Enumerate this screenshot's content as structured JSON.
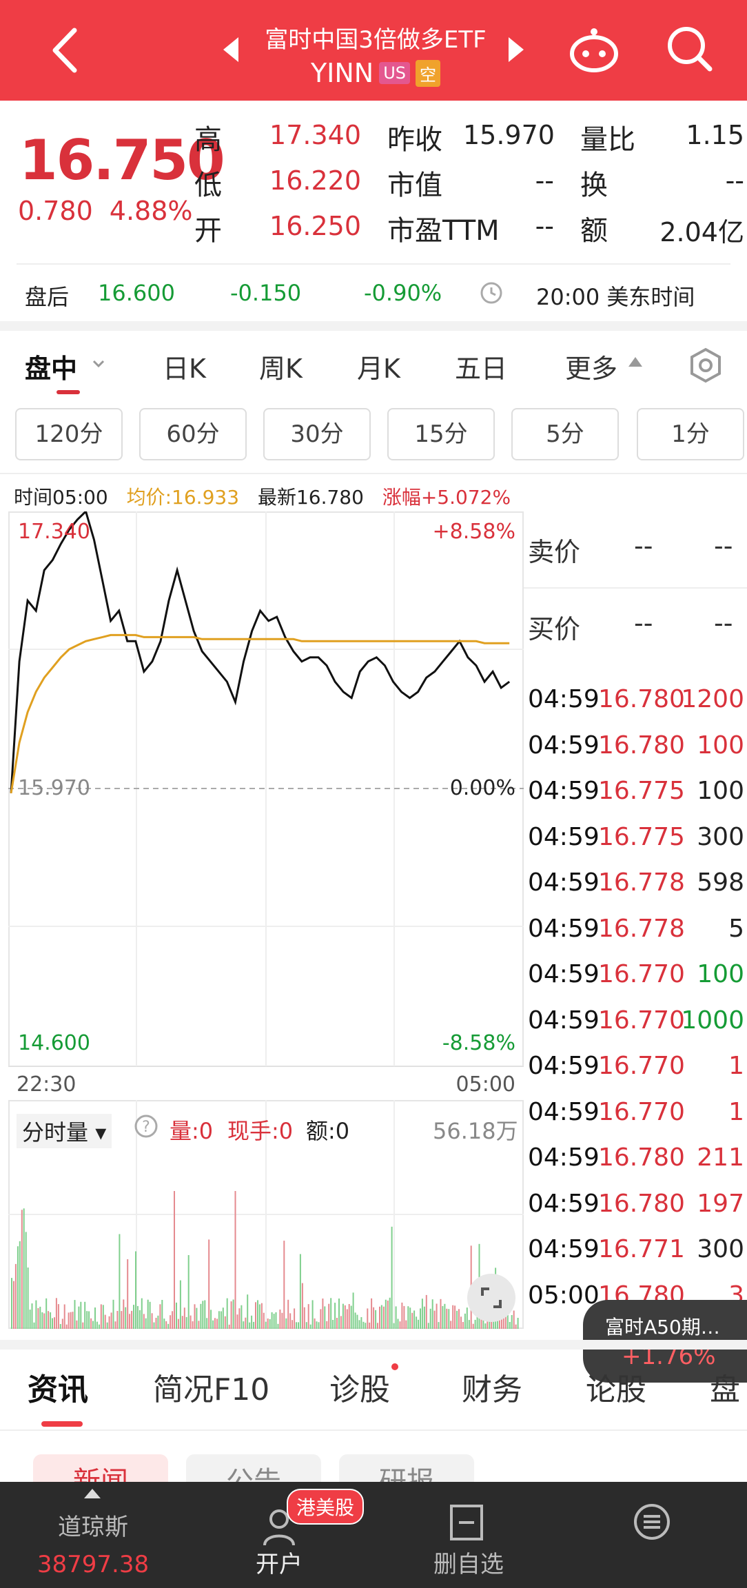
{
  "header": {
    "title": "富时中国3倍做多ETF",
    "ticker": "YINN",
    "market_badge": "US",
    "short_badge": "空",
    "icons": [
      "back-icon",
      "prev-icon",
      "next-icon",
      "bot-icon",
      "search-icon"
    ]
  },
  "quote": {
    "price": "16.750",
    "change": "0.780",
    "change_pct": "4.88%",
    "rows": [
      {
        "l1": "高",
        "v1": "17.340",
        "l2": "昨收",
        "v2": "15.970",
        "l3": "量比",
        "v3": "1.15"
      },
      {
        "l1": "低",
        "v1": "16.220",
        "l2": "市值",
        "v2": "--",
        "l3": "换",
        "v3": "--"
      },
      {
        "l1": "开",
        "v1": "16.250",
        "l2": "市盈TTM",
        "v2": "--",
        "l3": "额",
        "v3": "2.04亿"
      }
    ]
  },
  "after_hours": {
    "label": "盘后",
    "price": "16.600",
    "change": "-0.150",
    "change_pct": "-0.90%",
    "time": "20:00 美东时间"
  },
  "tabs": [
    "盘中",
    "日K",
    "周K",
    "月K",
    "五日",
    "更多"
  ],
  "periods": [
    "120分",
    "60分",
    "30分",
    "15分",
    "5分",
    "1分"
  ],
  "info_line": {
    "time": "时间05:00",
    "avg": "均价:16.933",
    "latest": "最新16.780",
    "change": "涨幅+5.072%"
  },
  "chart_data": {
    "type": "line",
    "y_high_label": "17.340",
    "y_low_label": "14.600",
    "y_mid_label": "15.970",
    "pct_high": "+8.58%",
    "pct_mid": "0.00%",
    "pct_low": "-8.58%",
    "x_start": "22:30",
    "x_end": "05:00",
    "ylim": [
      14.6,
      17.34
    ],
    "series": [
      {
        "values": [
          15.95,
          16.6,
          16.9,
          16.85,
          17.05,
          17.1,
          17.18,
          17.25,
          17.3,
          17.34,
          17.2,
          17.0,
          16.8,
          16.85,
          16.7,
          16.7,
          16.55,
          16.6,
          16.7,
          16.9,
          17.05,
          16.9,
          16.75,
          16.65,
          16.6,
          16.55,
          16.5,
          16.4,
          16.6,
          16.75,
          16.85,
          16.8,
          16.82,
          16.72,
          16.65,
          16.6,
          16.62,
          16.62,
          16.58,
          16.5,
          16.45,
          16.42,
          16.55,
          16.6,
          16.62,
          16.58,
          16.5,
          16.45,
          16.42,
          16.45,
          16.52,
          16.55,
          16.6,
          16.65,
          16.7,
          16.62,
          16.58,
          16.5,
          16.55,
          16.47,
          16.5
        ]
      },
      {
        "values": [
          15.95,
          16.2,
          16.35,
          16.45,
          16.52,
          16.57,
          16.62,
          16.66,
          16.68,
          16.7,
          16.71,
          16.72,
          16.73,
          16.73,
          16.73,
          16.73,
          16.72,
          16.72,
          16.72,
          16.72,
          16.72,
          16.72,
          16.72,
          16.71,
          16.71,
          16.71,
          16.71,
          16.71,
          16.71,
          16.71,
          16.71,
          16.71,
          16.71,
          16.71,
          16.71,
          16.7,
          16.7,
          16.7,
          16.7,
          16.7,
          16.7,
          16.7,
          16.7,
          16.7,
          16.7,
          16.7,
          16.7,
          16.7,
          16.7,
          16.7,
          16.7,
          16.7,
          16.7,
          16.7,
          16.7,
          16.7,
          16.7,
          16.69,
          16.69,
          16.69,
          16.69
        ]
      }
    ]
  },
  "book": {
    "ask_label": "卖价",
    "bid_label": "买价",
    "ask_price": "--",
    "ask_size": "--",
    "bid_price": "--",
    "bid_size": "--",
    "ticks": [
      {
        "t": "04:59",
        "p": "16.780",
        "v": "1200",
        "c": "red"
      },
      {
        "t": "04:59",
        "p": "16.780",
        "v": "100",
        "c": "red"
      },
      {
        "t": "04:59",
        "p": "16.775",
        "v": "100",
        "c": "dark"
      },
      {
        "t": "04:59",
        "p": "16.775",
        "v": "300",
        "c": "dark"
      },
      {
        "t": "04:59",
        "p": "16.778",
        "v": "598",
        "c": "dark"
      },
      {
        "t": "04:59",
        "p": "16.778",
        "v": "5",
        "c": "dark"
      },
      {
        "t": "04:59",
        "p": "16.770",
        "v": "100",
        "c": "green"
      },
      {
        "t": "04:59",
        "p": "16.770",
        "v": "1000",
        "c": "green"
      },
      {
        "t": "04:59",
        "p": "16.770",
        "v": "1",
        "c": "red"
      },
      {
        "t": "04:59",
        "p": "16.770",
        "v": "1",
        "c": "red"
      },
      {
        "t": "04:59",
        "p": "16.780",
        "v": "211",
        "c": "red"
      },
      {
        "t": "04:59",
        "p": "16.780",
        "v": "197",
        "c": "red"
      },
      {
        "t": "04:59",
        "p": "16.771",
        "v": "300",
        "c": "dark"
      },
      {
        "t": "05:00",
        "p": "16.780",
        "v": "3",
        "c": "red"
      }
    ]
  },
  "volume": {
    "label": "分时量",
    "qty": "量:0",
    "hand": "现手:0",
    "amount": "额:0",
    "max": "56.18万"
  },
  "floating": {
    "name": "富时A50期…",
    "value": "+1.76%"
  },
  "news_tabs": [
    "资讯",
    "简况F10",
    "诊股",
    "财务",
    "论股",
    "盘"
  ],
  "chips": [
    "新闻",
    "公告",
    "研报"
  ],
  "bottom_nav": {
    "index_name": "道琼斯",
    "index_value": "38797.38",
    "open": "开户",
    "promo": "港美股",
    "watch": "删自选"
  },
  "colors": {
    "brand": "#ef3d45",
    "up": "#d9313b",
    "down": "#159b35",
    "avg_line": "#e0a020"
  }
}
